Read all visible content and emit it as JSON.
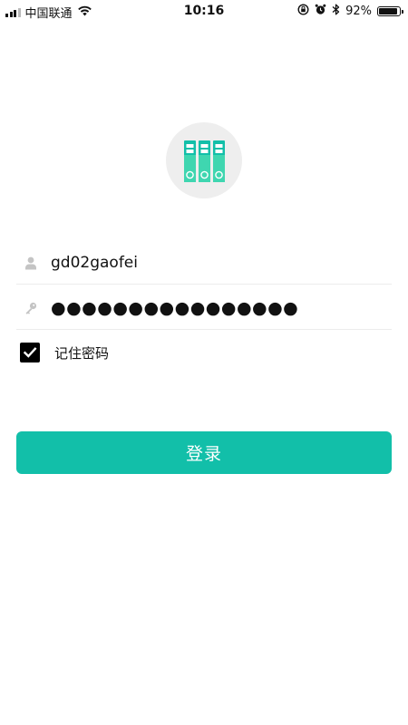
{
  "status_bar": {
    "carrier": "中国联通",
    "time": "10:16",
    "battery_text": "92%",
    "battery_level": 0.92,
    "icons": [
      "signal-icon",
      "wifi-icon",
      "orientation-lock-icon",
      "alarm-icon",
      "bluetooth-icon",
      "battery-icon"
    ]
  },
  "logo": {
    "icon": "binders-icon",
    "colors": {
      "circle": "#eeeeee",
      "binder_primary": "#12bfa9",
      "binder_secondary": "#3fd6b0"
    }
  },
  "login_form": {
    "username_value": "gd02gaofei",
    "username_icon": "user-icon",
    "password_value": "●●●●●●●●●●●●●●●●",
    "password_icon": "key-icon",
    "remember_label": "记住密码",
    "remember_checked": true,
    "submit_label": "登录"
  },
  "colors": {
    "accent": "#12bfa9",
    "checkbox": "#000000",
    "divider": "#ececec"
  }
}
